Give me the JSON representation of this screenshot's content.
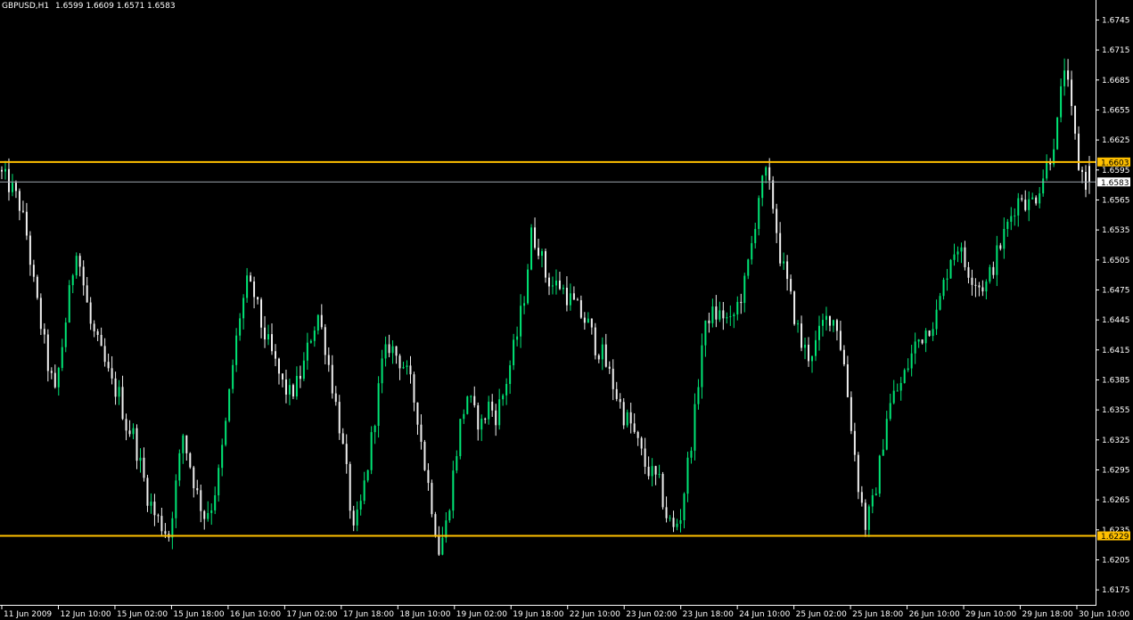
{
  "header": {
    "symbol": "GBPUSD,H1",
    "ohlc": "1.6599 1.6609 1.6571 1.6583"
  },
  "colors": {
    "background": "#000000",
    "axis": "#ffffff",
    "bull": "#00e676",
    "bear": "#f0f0f0",
    "level_line": "#ffc000",
    "price_line": "#a0a8b0"
  },
  "chart_data": {
    "type": "candlestick",
    "symbol": "GBPUSD",
    "timeframe": "H1",
    "ylim": [
      1.616,
      1.6765
    ],
    "y_ticks": [
      "1.6745",
      "1.6715",
      "1.6685",
      "1.6655",
      "1.6625",
      "1.6595",
      "1.6565",
      "1.6535",
      "1.6505",
      "1.6475",
      "1.6445",
      "1.6415",
      "1.6385",
      "1.6355",
      "1.6325",
      "1.6295",
      "1.6265",
      "1.6235",
      "1.6205",
      "1.6175"
    ],
    "x_ticks": [
      "11 Jun 2009",
      "12 Jun 10:00",
      "15 Jun 02:00",
      "15 Jun 18:00",
      "16 Jun 10:00",
      "17 Jun 02:00",
      "17 Jun 18:00",
      "18 Jun 10:00",
      "19 Jun 02:00",
      "19 Jun 18:00",
      "22 Jun 10:00",
      "23 Jun 02:00",
      "23 Jun 18:00",
      "24 Jun 10:00",
      "25 Jun 02:00",
      "25 Jun 18:00",
      "26 Jun 10:00",
      "29 Jun 10:00",
      "29 Jun 18:00",
      "30 Jun 10:00"
    ],
    "levels": [
      {
        "label": "1.6603",
        "value": 1.6603,
        "kind": "horizontal-line"
      },
      {
        "label": "1.6229",
        "value": 1.6229,
        "kind": "horizontal-line"
      }
    ],
    "current_price": {
      "label": "1.6583",
      "value": 1.6583
    },
    "last_bar": {
      "open": 1.6599,
      "high": 1.6609,
      "low": 1.6571,
      "close": 1.6583
    },
    "path_close": [
      1.6595,
      1.6585,
      1.6575,
      1.656,
      1.653,
      1.648,
      1.644,
      1.64,
      1.637,
      1.642,
      1.647,
      1.652,
      1.648,
      1.644,
      1.642,
      1.64,
      1.638,
      1.637,
      1.634,
      1.633,
      1.63,
      1.627,
      1.625,
      1.624,
      1.623,
      1.628,
      1.633,
      1.63,
      1.627,
      1.625,
      1.626,
      1.629,
      1.634,
      1.64,
      1.645,
      1.648,
      1.647,
      1.644,
      1.642,
      1.64,
      1.638,
      1.637,
      1.638,
      1.64,
      1.643,
      1.645,
      1.642,
      1.638,
      1.634,
      1.629,
      1.623,
      1.626,
      1.63,
      1.635,
      1.64,
      1.642,
      1.641,
      1.64,
      1.638,
      1.635,
      1.63,
      1.626,
      1.6215,
      1.624,
      1.629,
      1.634,
      1.637,
      1.635,
      1.634,
      1.636,
      1.635,
      1.637,
      1.64,
      1.643,
      1.647,
      1.653,
      1.652,
      1.649,
      1.648,
      1.648,
      1.647,
      1.646,
      1.645,
      1.644,
      1.642,
      1.641,
      1.639,
      1.637,
      1.635,
      1.634,
      1.632,
      1.63,
      1.629,
      1.628,
      1.625,
      1.6235,
      1.625,
      1.63,
      1.635,
      1.642,
      1.645,
      1.645,
      1.645,
      1.644,
      1.646,
      1.648,
      1.652,
      1.657,
      1.659,
      1.656,
      1.651,
      1.648,
      1.645,
      1.642,
      1.641,
      1.642,
      1.644,
      1.645,
      1.644,
      1.64,
      1.634,
      1.628,
      1.624,
      1.626,
      1.63,
      1.635,
      1.637,
      1.638,
      1.64,
      1.642,
      1.643,
      1.644,
      1.645,
      1.648,
      1.651,
      1.652,
      1.65,
      1.649,
      1.648,
      1.648,
      1.65,
      1.652,
      1.654,
      1.656,
      1.657,
      1.656,
      1.657,
      1.659,
      1.661,
      1.664,
      1.67,
      1.665,
      1.66,
      1.6583
    ]
  }
}
